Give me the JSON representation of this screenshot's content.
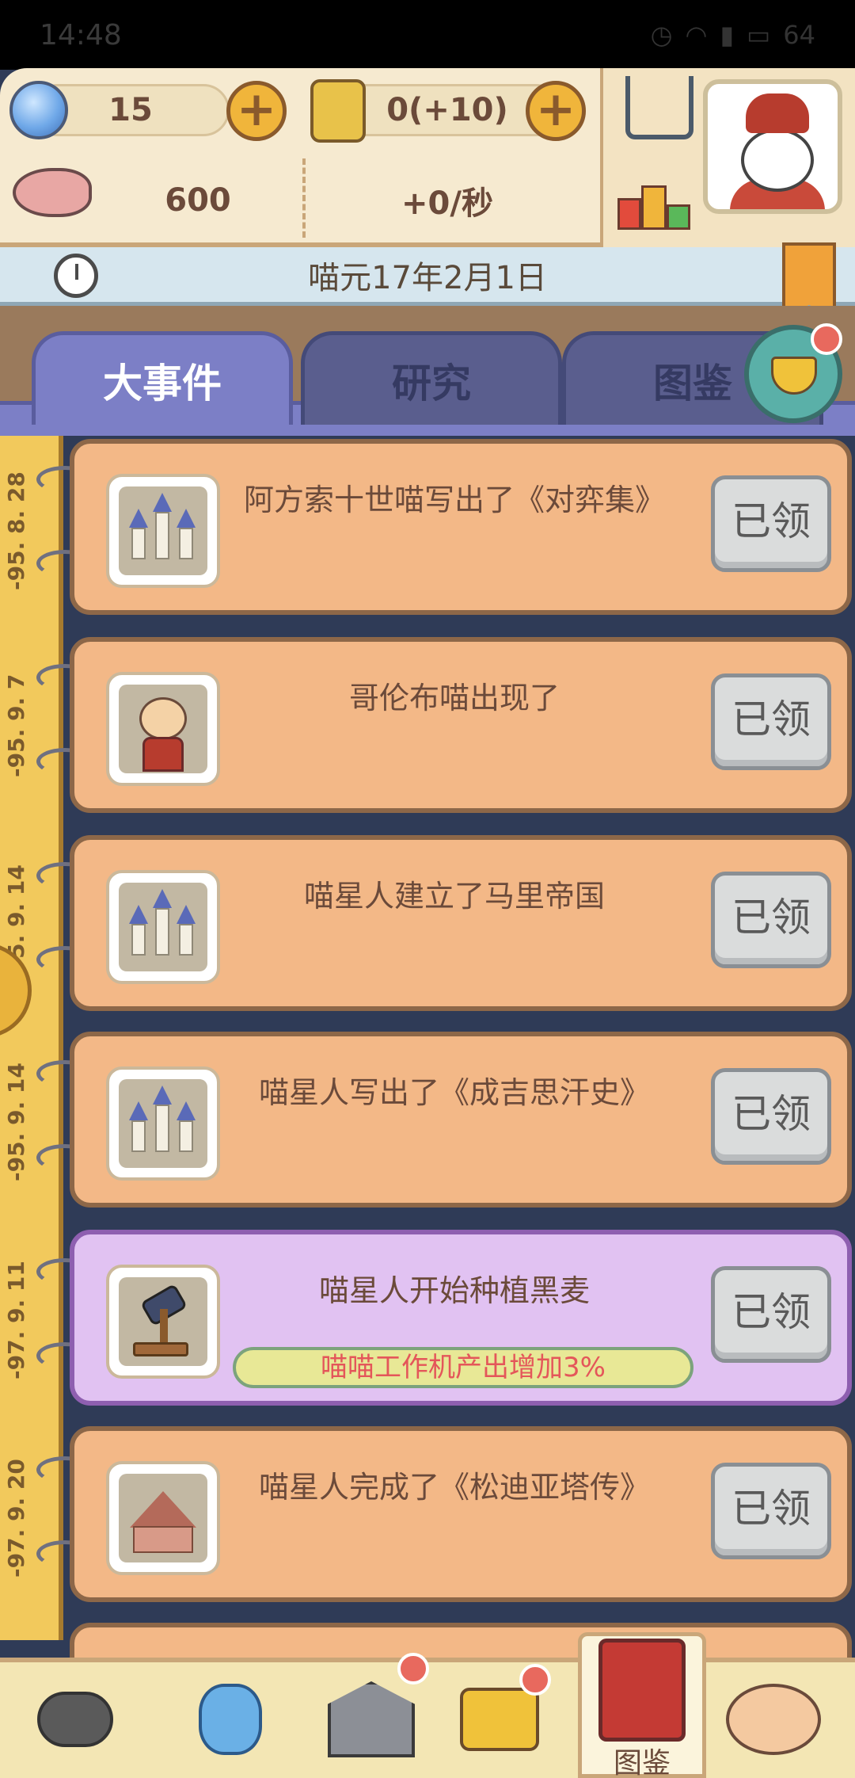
{
  "status_bar": {
    "time": "14:48",
    "battery": "64"
  },
  "resources": {
    "gems": "15",
    "scrolls": "0(+10)",
    "fish": "600",
    "fish_rate": "+0/秒"
  },
  "date_bar": {
    "date": "喵元17年2月1日"
  },
  "tabs": [
    {
      "label": "大事件",
      "active": true
    },
    {
      "label": "研究",
      "active": false
    },
    {
      "label": "图鉴",
      "active": false
    }
  ],
  "timeline_labels": [
    "-95. 8. 28",
    "-95. 9. 7",
    "-95. 9. 14",
    "-95. 9. 14",
    "-97. 9. 11",
    "-97. 9. 20"
  ],
  "events": [
    {
      "title": "阿方索十世喵写出了《对弈集》",
      "button": "已领",
      "icon": "castle-icon"
    },
    {
      "title": "哥伦布喵出现了",
      "button": "已领",
      "icon": "cat-character-icon"
    },
    {
      "title": "喵星人建立了马里帝国",
      "button": "已领",
      "icon": "castle-icon"
    },
    {
      "title": "喵星人写出了《成吉思汗史》",
      "button": "已领",
      "icon": "castle-icon"
    },
    {
      "title": "喵星人开始种植黑麦",
      "button": "已领",
      "icon": "hammer-icon",
      "subtitle": "喵喵工作机产出增加3%"
    },
    {
      "title": "喵星人完成了《松迪亚塔传》",
      "button": "已领",
      "icon": "hut-icon"
    }
  ],
  "bottom_nav": {
    "active_label": "图鉴"
  }
}
